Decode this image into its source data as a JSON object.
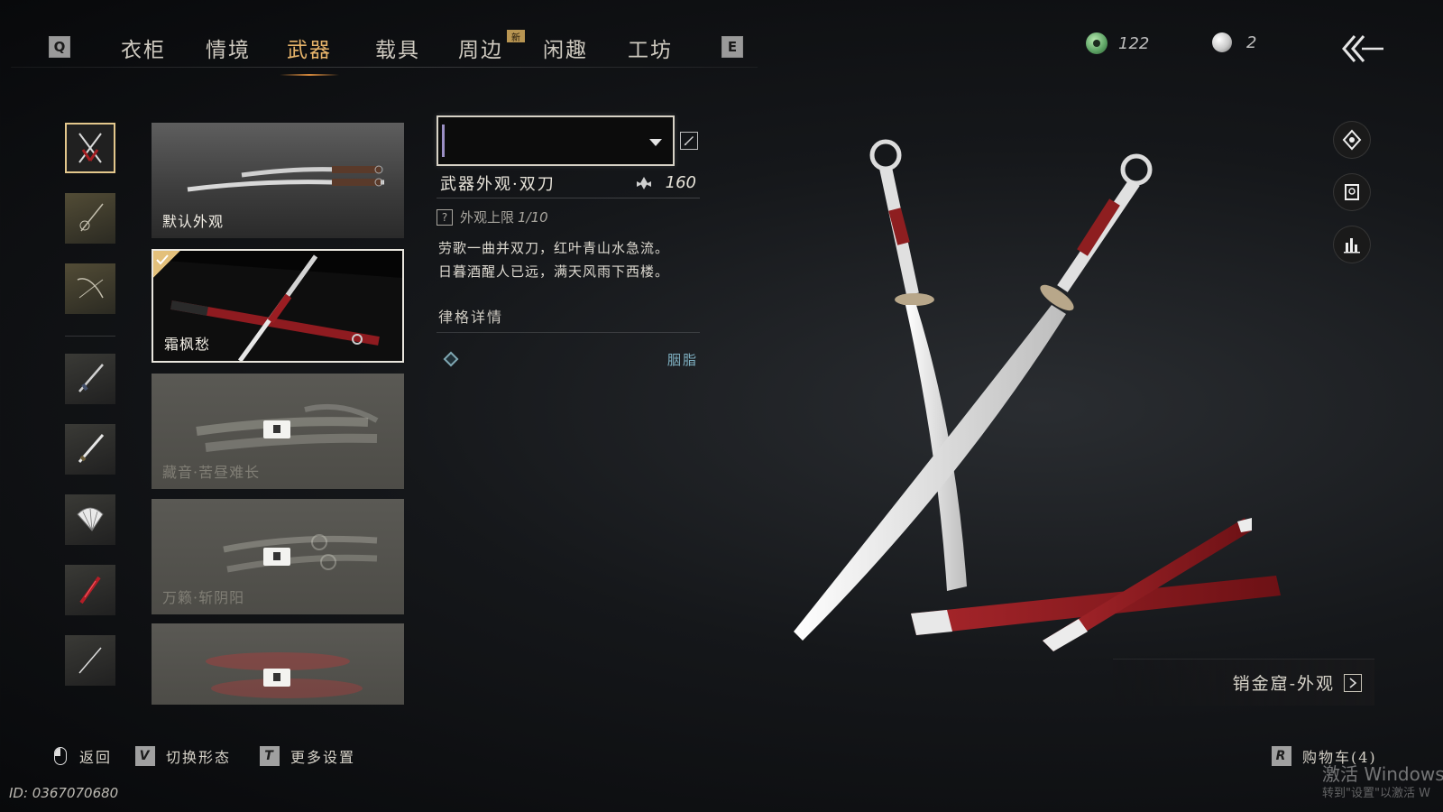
{
  "nav": {
    "left_key": "Q",
    "right_key": "E",
    "tabs": [
      {
        "label": "衣柜"
      },
      {
        "label": "情境"
      },
      {
        "label": "武器"
      },
      {
        "label": "载具"
      },
      {
        "label": "周边"
      },
      {
        "label": "闲趣"
      },
      {
        "label": "工坊"
      }
    ],
    "active_tab": "武器",
    "new_badge": "新"
  },
  "currency": {
    "jade": {
      "icon": "jade-coin-icon",
      "value": "122"
    },
    "pearl": {
      "icon": "pearl-icon",
      "value": "2"
    }
  },
  "categories": [
    {
      "icon": "crossed-blades-icon",
      "selected": true
    },
    {
      "icon": "spear-tassel-icon"
    },
    {
      "icon": "bow-icon"
    },
    {
      "icon": "sword-icon"
    },
    {
      "icon": "long-blade-icon"
    },
    {
      "icon": "fan-icon"
    },
    {
      "icon": "umbrella-icon"
    },
    {
      "icon": "dart-icon"
    }
  ],
  "skins": [
    {
      "label": "默认外观",
      "state": "owned"
    },
    {
      "label": "霜枫愁",
      "state": "selected"
    },
    {
      "label": "藏音·苦昼难长",
      "state": "locked"
    },
    {
      "label": "万籁·斩阴阳",
      "state": "locked"
    },
    {
      "label": "",
      "state": "locked"
    }
  ],
  "details": {
    "type": "武器外观·双刀",
    "cost": "160",
    "limit_label": "外观上限",
    "limit_value": "1/10",
    "help_key": "?",
    "poem_line1": "劳歌一曲并双刀，红叶青山水急流。",
    "poem_line2": "日暮酒醒人已远，满天风雨下西楼。",
    "section_title": "律格详情",
    "rule_label": "胭脂"
  },
  "source": {
    "label": "销金窟-外观"
  },
  "bottom": {
    "back": "返回",
    "switch_key": "V",
    "switch": "切换形态",
    "more_key": "T",
    "more": "更多设置",
    "cart_key": "R",
    "cart": "购物车(4)"
  },
  "player_id": "ID: 0367070680",
  "watermark": {
    "line1": "激活 Windows",
    "line2": "转到\"设置\"以激活 W"
  },
  "colors": {
    "accent": "#e6b36a",
    "blade_red": "#8e1e20",
    "panel_border": "#e9e6de"
  }
}
